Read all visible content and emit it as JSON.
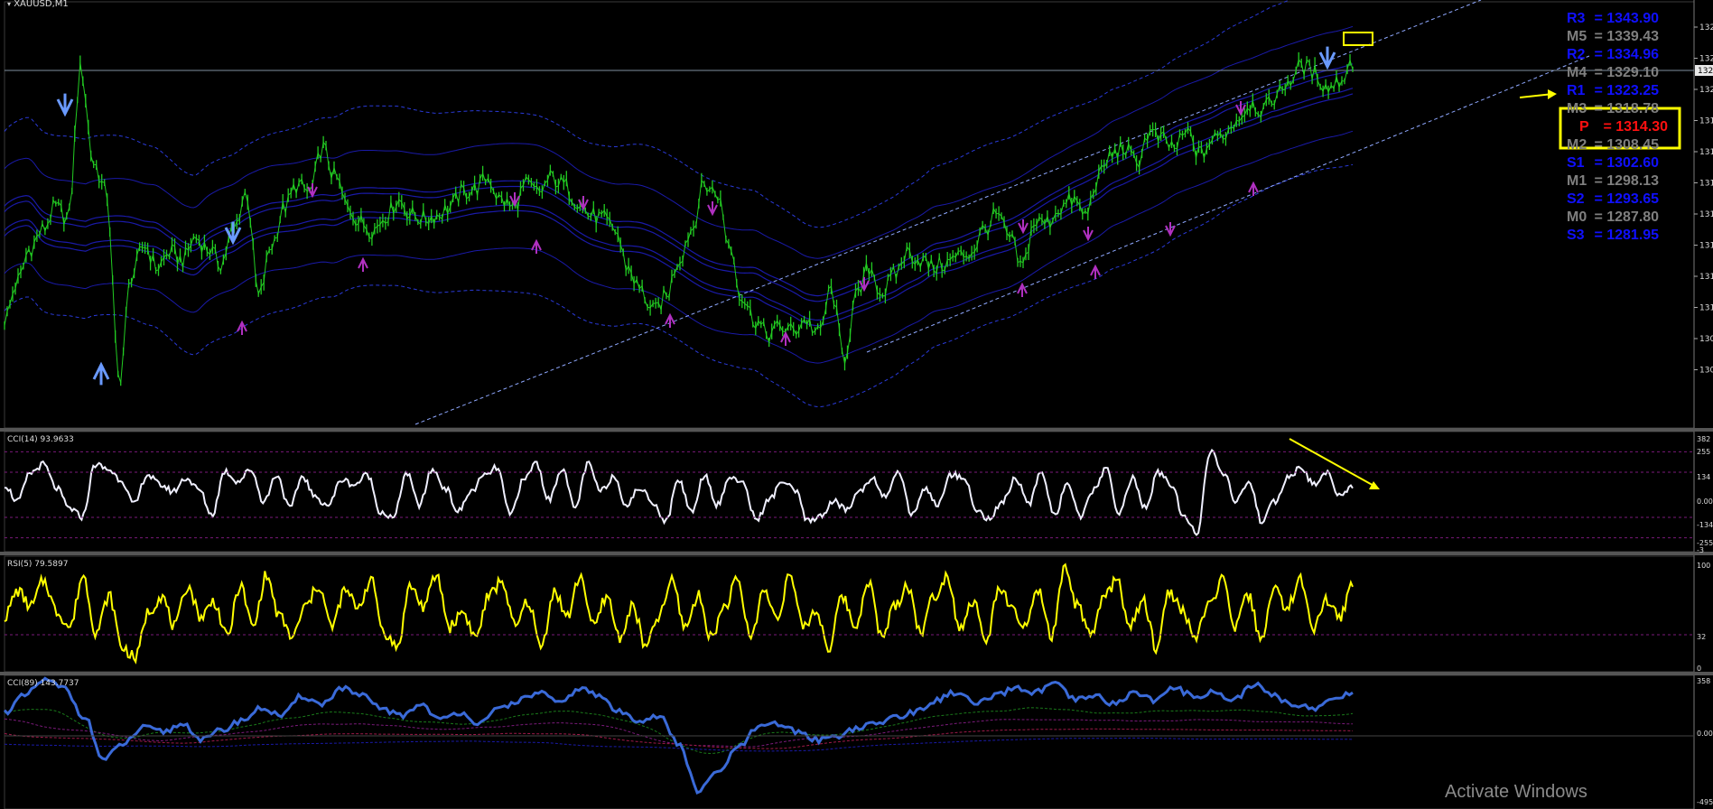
{
  "symbol_label": "XAUUSD,M1",
  "watermark": "Activate Windows",
  "colors": {
    "background": "#000000",
    "price_line": "#22cc22",
    "band_solid": "#1a1aa8",
    "band_dashed": "#2a3ad8",
    "trend_line": "#8fa8ff",
    "cci14": "#f0f0ff",
    "rsi": "#ffff00",
    "cci89": "#3a6ad8",
    "annotation": "#ffff00",
    "arrow_down": "#6a9aff",
    "arrow_up_marker": "#b030c0"
  },
  "pivot_levels": [
    {
      "name": "R3",
      "value": "1343.90",
      "color": "#1010ff"
    },
    {
      "name": "M5",
      "value": "1339.43",
      "color": "#7f7f7f"
    },
    {
      "name": "R2",
      "value": "1334.96",
      "color": "#1010ff"
    },
    {
      "name": "M4",
      "value": "1329.10",
      "color": "#7f7f7f"
    },
    {
      "name": "R1",
      "value": "1323.25",
      "color": "#1010ff"
    },
    {
      "name": "M3",
      "value": "1318.78",
      "color": "#7f7f7f"
    },
    {
      "name": "P",
      "value": "1314.30",
      "color": "#ff1010"
    },
    {
      "name": "M2",
      "value": "1308.45",
      "color": "#7f7f7f"
    },
    {
      "name": "S1",
      "value": "1302.60",
      "color": "#1010ff"
    },
    {
      "name": "M1",
      "value": "1298.13",
      "color": "#7f7f7f"
    },
    {
      "name": "S2",
      "value": "1293.65",
      "color": "#1010ff"
    },
    {
      "name": "M0",
      "value": "1287.80",
      "color": "#7f7f7f"
    },
    {
      "name": "S3",
      "value": "1281.95",
      "color": "#1010ff"
    }
  ],
  "panels": {
    "main": {
      "y_ticks": [
        "132",
        "132",
        "132",
        "131",
        "131",
        "131",
        "131",
        "131",
        "131",
        "131",
        "130",
        "130"
      ],
      "current_price": "132"
    },
    "cci14": {
      "title": "CCI(14) 93.9633",
      "y_ticks": [
        "382",
        "255",
        "134",
        "0.00",
        "-134",
        "-255",
        "-3"
      ]
    },
    "rsi5": {
      "title": "RSI(5) 79.5897",
      "y_ticks": [
        "100",
        "32",
        "0"
      ]
    },
    "cci89": {
      "title": "CCI(89) 143.7737",
      "y_ticks": [
        "358",
        "0.00",
        "-495"
      ]
    }
  },
  "chart_data": [
    {
      "type": "line",
      "panel": "price",
      "series": [
        {
          "values": [
            0.28,
            0.38,
            0.47,
            0.52,
            0.58,
            0.55,
            0.95,
            0.7,
            0.62,
            0.12,
            0.4,
            0.48,
            0.42,
            0.46,
            0.44,
            0.5,
            0.47,
            0.43,
            0.52,
            0.62,
            0.34,
            0.48,
            0.58,
            0.64,
            0.62,
            0.74,
            0.66,
            0.58,
            0.54,
            0.52,
            0.56,
            0.6,
            0.56,
            0.55,
            0.56,
            0.58,
            0.62,
            0.63,
            0.66,
            0.6,
            0.58,
            0.64,
            0.62,
            0.66,
            0.64,
            0.6,
            0.56,
            0.55,
            0.52,
            0.42,
            0.36,
            0.3,
            0.34,
            0.44,
            0.52,
            0.64,
            0.62,
            0.48,
            0.34,
            0.28,
            0.24,
            0.26,
            0.25,
            0.28,
            0.24,
            0.36,
            0.18,
            0.34,
            0.42,
            0.35,
            0.4,
            0.46,
            0.44,
            0.42,
            0.43,
            0.45,
            0.46,
            0.52,
            0.56,
            0.5,
            0.42,
            0.54,
            0.54,
            0.58,
            0.6,
            0.56,
            0.66,
            0.72,
            0.74,
            0.7,
            0.78,
            0.76,
            0.74,
            0.78,
            0.72,
            0.76,
            0.78,
            0.82,
            0.86,
            0.84,
            0.88,
            0.92,
            0.96,
            0.94,
            0.9,
            0.92,
            0.97
          ]
        }
      ]
    },
    {
      "type": "line",
      "panel": "cci14",
      "series": [
        {
          "values": [
            60,
            -40,
            130,
            180,
            40,
            -80,
            -130,
            180,
            150,
            90,
            -60,
            120,
            60,
            20,
            100,
            30,
            -120,
            140,
            80,
            150,
            -40,
            120,
            -80,
            110,
            -20,
            -60,
            90,
            60,
            120,
            -100,
            -140,
            130,
            -60,
            150,
            40,
            -100,
            20,
            110,
            160,
            -120,
            80,
            190,
            -30,
            160,
            -80,
            180,
            20,
            110,
            -60,
            40,
            -40,
            -160,
            90,
            -100,
            120,
            -60,
            110,
            60,
            -150,
            -30,
            80,
            20,
            -160,
            -120,
            -40,
            -90,
            30,
            100,
            -20,
            140,
            -120,
            40,
            -60,
            120,
            110,
            -100,
            -140,
            -40,
            100,
            -60,
            140,
            -120,
            70,
            -140,
            30,
            150,
            -110,
            100,
            -80,
            130,
            60,
            -140,
            -220,
            260,
            130,
            -40,
            80,
            -160,
            -40,
            100,
            160,
            60,
            130,
            0,
            50
          ]
        }
      ]
    },
    {
      "type": "line",
      "panel": "rsi5",
      "series": [
        {
          "values": [
            50,
            75,
            60,
            85,
            55,
            40,
            90,
            35,
            70,
            20,
            10,
            55,
            70,
            40,
            80,
            50,
            65,
            30,
            80,
            40,
            90,
            50,
            30,
            60,
            80,
            40,
            75,
            60,
            85,
            35,
            20,
            80,
            60,
            90,
            40,
            55,
            30,
            70,
            85,
            40,
            65,
            20,
            75,
            50,
            90,
            40,
            70,
            30,
            60,
            20,
            50,
            85,
            40,
            70,
            30,
            60,
            85,
            30,
            75,
            50,
            90,
            40,
            55,
            20,
            70,
            40,
            85,
            30,
            60,
            80,
            35,
            70,
            90,
            40,
            65,
            25,
            80,
            55,
            40,
            75,
            30,
            95,
            60,
            30,
            70,
            85,
            40,
            65,
            20,
            75,
            55,
            30,
            60,
            85,
            40,
            70,
            30,
            75,
            60,
            85,
            40,
            65,
            50,
            80
          ]
        }
      ]
    },
    {
      "type": "line",
      "panel": "cci89",
      "series": [
        {
          "values": [
            120,
            200,
            280,
            240,
            100,
            -120,
            -40,
            40,
            20,
            60,
            -20,
            30,
            80,
            140,
            100,
            200,
            160,
            240,
            200,
            140,
            100,
            160,
            80,
            120,
            60,
            140,
            180,
            220,
            160,
            240,
            200,
            120,
            80,
            100,
            -40,
            -280,
            -180,
            -60,
            40,
            60,
            20,
            -20,
            0,
            40,
            60,
            100,
            120,
            180,
            220,
            160,
            200,
            240,
            220,
            260,
            180,
            200,
            160,
            220,
            180,
            240,
            200,
            220,
            180,
            260,
            200,
            160,
            140,
            180,
            220
          ]
        }
      ]
    }
  ]
}
